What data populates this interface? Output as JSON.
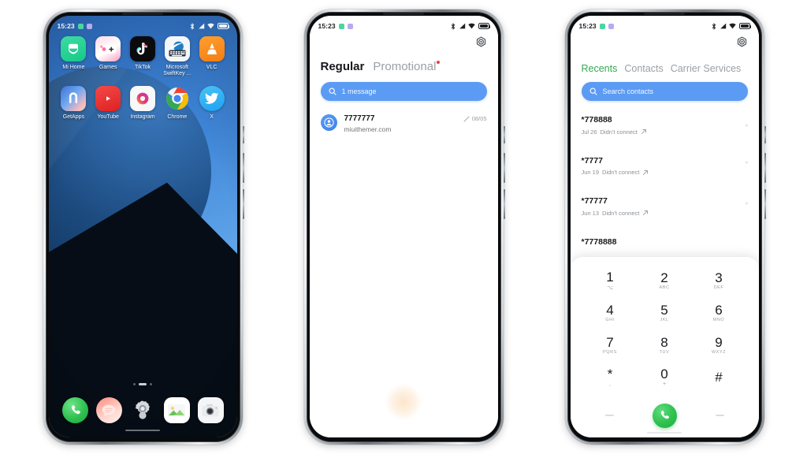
{
  "background_color": "#ffffff",
  "phones": [
    {
      "id": "phone-home",
      "status_bar": {
        "time": "15:23",
        "notification_icons": [
          "green-square-icon",
          "violet-square-icon"
        ],
        "right_icons": [
          "bluetooth-icon",
          "signal-icon",
          "wifi-icon",
          "battery-icon"
        ]
      },
      "screen": "home-screen",
      "apps_row1": [
        {
          "label": "Mi Home",
          "icon": "mi-home-icon"
        },
        {
          "label": "Games",
          "icon": "games-icon"
        },
        {
          "label": "TikTok",
          "icon": "tiktok-icon"
        },
        {
          "label": "Microsoft SwiftKey ...",
          "icon": "swiftkey-icon"
        },
        {
          "label": "VLC",
          "icon": "vlc-icon"
        }
      ],
      "apps_row2": [
        {
          "label": "GetApps",
          "icon": "getapps-icon"
        },
        {
          "label": "YouTube",
          "icon": "youtube-icon"
        },
        {
          "label": "Instagram",
          "icon": "instagram-icon"
        },
        {
          "label": "Chrome",
          "icon": "chrome-icon"
        },
        {
          "label": "X",
          "icon": "x-twitter-icon"
        }
      ],
      "dock": [
        {
          "label": "Phone",
          "icon": "phone-icon"
        },
        {
          "label": "Messages",
          "icon": "messages-icon"
        },
        {
          "label": "Settings",
          "icon": "settings-gear-icon"
        },
        {
          "label": "Gallery",
          "icon": "gallery-icon"
        },
        {
          "label": "Camera",
          "icon": "camera-icon"
        }
      ]
    },
    {
      "id": "phone-messages",
      "status_bar": {
        "time": "15:23",
        "notification_icons": [
          "green-square-icon",
          "violet-square-icon"
        ],
        "right_icons": [
          "bluetooth-icon",
          "signal-icon",
          "wifi-icon",
          "battery-icon"
        ]
      },
      "screen": "messages-app",
      "settings_icon": "gear-icon",
      "tabs": [
        {
          "label": "Regular",
          "active": true,
          "badge": false
        },
        {
          "label": "Promotional",
          "active": false,
          "badge": true
        }
      ],
      "search": {
        "icon": "search-icon",
        "value": "1 message",
        "placeholder": "1 message"
      },
      "conversations": [
        {
          "avatar": "contact-avatar-icon",
          "name": "7777777",
          "preview": "miuithemer.com",
          "status_icon": "sent-pencil-icon",
          "date": "08/05"
        }
      ]
    },
    {
      "id": "phone-dialer",
      "status_bar": {
        "time": "15:23",
        "notification_icons": [
          "green-square-icon",
          "violet-square-icon"
        ],
        "right_icons": [
          "bluetooth-icon",
          "signal-icon",
          "wifi-icon",
          "battery-icon"
        ]
      },
      "screen": "dialer-app",
      "settings_icon": "gear-icon",
      "tabs": [
        {
          "label": "Recents",
          "active": true
        },
        {
          "label": "Contacts",
          "active": false
        },
        {
          "label": "Carrier Services",
          "active": false
        }
      ],
      "search": {
        "icon": "search-icon",
        "value": "",
        "placeholder": "Search contacts"
      },
      "call_log": [
        {
          "number": "*778888",
          "date": "Jul 26",
          "status": "Didn't connect",
          "direction_icon": "outgoing-call-arrow-icon"
        },
        {
          "number": "*7777",
          "date": "Jun 19",
          "status": "Didn't connect",
          "direction_icon": "outgoing-call-arrow-icon"
        },
        {
          "number": "*77777",
          "date": "Jun 13",
          "status": "Didn't connect",
          "direction_icon": "outgoing-call-arrow-icon"
        },
        {
          "number": "*7778888",
          "date": "",
          "status": "",
          "direction_icon": "outgoing-call-arrow-icon"
        }
      ],
      "dialpad": [
        {
          "digit": "1",
          "sub": "⌥"
        },
        {
          "digit": "2",
          "sub": "ABC"
        },
        {
          "digit": "3",
          "sub": "DEF"
        },
        {
          "digit": "4",
          "sub": "GHI"
        },
        {
          "digit": "5",
          "sub": "JKL"
        },
        {
          "digit": "6",
          "sub": "MNO"
        },
        {
          "digit": "7",
          "sub": "PQRS"
        },
        {
          "digit": "8",
          "sub": "TUV"
        },
        {
          "digit": "9",
          "sub": "WXYZ"
        },
        {
          "digit": "*",
          "sub": ","
        },
        {
          "digit": "0",
          "sub": "+"
        },
        {
          "digit": "#",
          "sub": ""
        }
      ],
      "call_button": {
        "icon": "phone-call-icon",
        "color": "#31c352"
      }
    }
  ],
  "colors": {
    "search_blue": "#5b9bf3",
    "tab_green": "#34a853",
    "badge_red": "#e8413a",
    "call_green": "#31c352",
    "text_primary": "#17191c",
    "text_secondary": "#8b9096"
  }
}
